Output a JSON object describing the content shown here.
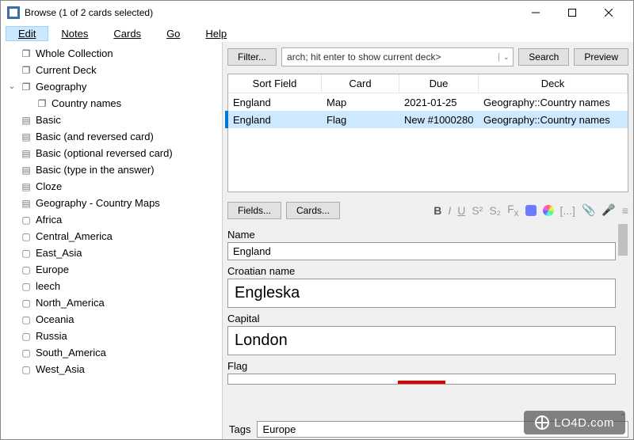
{
  "window": {
    "title": "Browse (1 of 2 cards selected)"
  },
  "menu": {
    "edit": "Edit",
    "notes": "Notes",
    "cards": "Cards",
    "go": "Go",
    "help": "Help"
  },
  "sidebar": {
    "items": [
      {
        "icon": "cards",
        "label": "Whole Collection",
        "indent": 0,
        "expand": "none"
      },
      {
        "icon": "cards",
        "label": "Current Deck",
        "indent": 0,
        "expand": "none"
      },
      {
        "icon": "cards",
        "label": "Geography",
        "indent": 0,
        "expand": "open"
      },
      {
        "icon": "cards",
        "label": "Country names",
        "indent": 1,
        "expand": "none"
      },
      {
        "icon": "book",
        "label": "Basic",
        "indent": 0,
        "expand": "none"
      },
      {
        "icon": "book",
        "label": "Basic (and reversed card)",
        "indent": 0,
        "expand": "none"
      },
      {
        "icon": "book",
        "label": "Basic (optional reversed card)",
        "indent": 0,
        "expand": "none"
      },
      {
        "icon": "book",
        "label": "Basic (type in the answer)",
        "indent": 0,
        "expand": "none"
      },
      {
        "icon": "book",
        "label": "Cloze",
        "indent": 0,
        "expand": "none"
      },
      {
        "icon": "book",
        "label": "Geography - Country Maps",
        "indent": 0,
        "expand": "none"
      },
      {
        "icon": "tag",
        "label": "Africa",
        "indent": 0,
        "expand": "none"
      },
      {
        "icon": "tag",
        "label": "Central_America",
        "indent": 0,
        "expand": "none"
      },
      {
        "icon": "tag",
        "label": "East_Asia",
        "indent": 0,
        "expand": "none"
      },
      {
        "icon": "tag",
        "label": "Europe",
        "indent": 0,
        "expand": "none"
      },
      {
        "icon": "tag",
        "label": "leech",
        "indent": 0,
        "expand": "none"
      },
      {
        "icon": "tag",
        "label": "North_America",
        "indent": 0,
        "expand": "none"
      },
      {
        "icon": "tag",
        "label": "Oceania",
        "indent": 0,
        "expand": "none"
      },
      {
        "icon": "tag",
        "label": "Russia",
        "indent": 0,
        "expand": "none"
      },
      {
        "icon": "tag",
        "label": "South_America",
        "indent": 0,
        "expand": "none"
      },
      {
        "icon": "tag",
        "label": "West_Asia",
        "indent": 0,
        "expand": "none"
      }
    ]
  },
  "toolbar": {
    "filter": "Filter...",
    "search_text": "arch; hit enter to show current deck>",
    "search": "Search",
    "preview": "Preview"
  },
  "table": {
    "headers": [
      "Sort Field",
      "Card",
      "Due",
      "Deck"
    ],
    "rows": [
      {
        "cells": [
          "England",
          "Map",
          "2021-01-25",
          "Geography::Country names"
        ],
        "selected": false
      },
      {
        "cells": [
          "England",
          "Flag",
          "New #1000280",
          "Geography::Country names"
        ],
        "selected": true
      }
    ]
  },
  "editor": {
    "fields_btn": "Fields...",
    "cards_btn": "Cards...",
    "fields": [
      {
        "label": "Name",
        "value": "England",
        "large": false
      },
      {
        "label": "Croatian name",
        "value": "Engleska",
        "large": true
      },
      {
        "label": "Capital",
        "value": "London",
        "large": true
      },
      {
        "label": "Flag",
        "value": "",
        "large": false,
        "is_flag": true
      }
    ],
    "tags_label": "Tags",
    "tags_value": "Europe"
  },
  "watermark": "LO4D.com"
}
